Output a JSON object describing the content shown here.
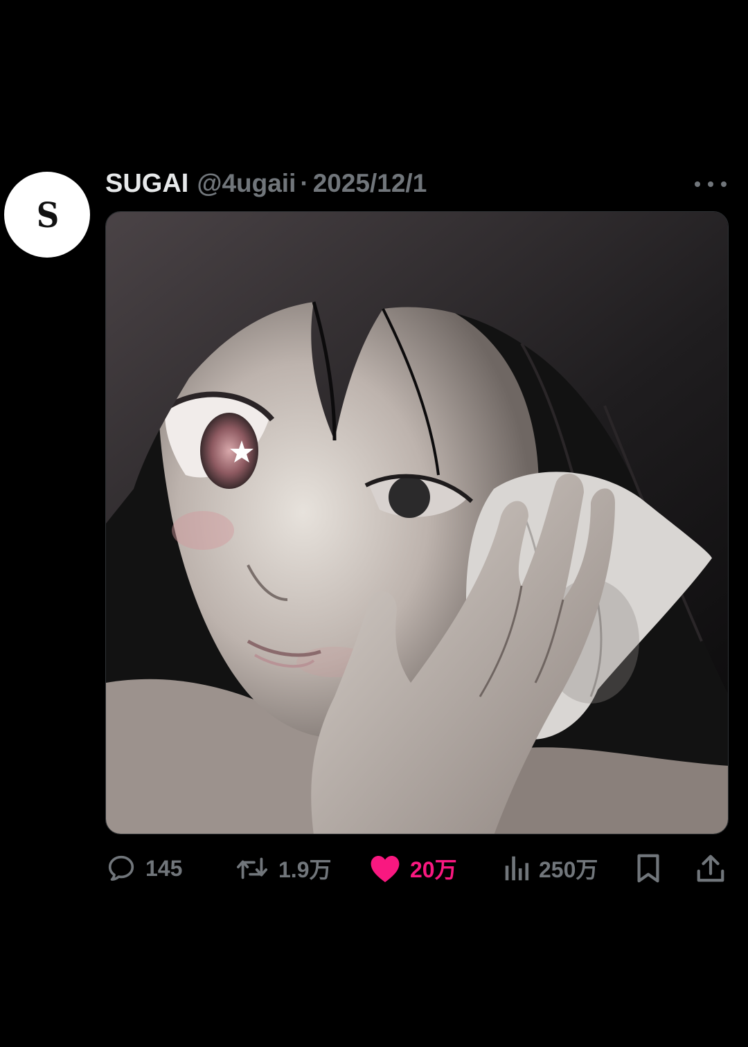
{
  "tweet": {
    "avatar_letter": "S",
    "display_name": "SUGAI",
    "handle": "@4ugaii",
    "separator": "·",
    "date": "2025/12/1",
    "media_description_icon": "illustration-image"
  },
  "actions": {
    "replies": {
      "icon": "reply-bubble-icon",
      "count": "145"
    },
    "reposts": {
      "icon": "repost-icon",
      "count": "1.9万"
    },
    "likes": {
      "icon": "heart-icon",
      "count": "20万",
      "liked": true,
      "color": "#f91880"
    },
    "views": {
      "icon": "views-bar-icon",
      "count": "250万"
    },
    "bookmark": {
      "icon": "bookmark-icon"
    },
    "share": {
      "icon": "share-icon"
    }
  },
  "colors": {
    "background": "#000000",
    "primary_text": "#e7e9ea",
    "secondary_text": "#71767b",
    "like": "#f91880"
  }
}
